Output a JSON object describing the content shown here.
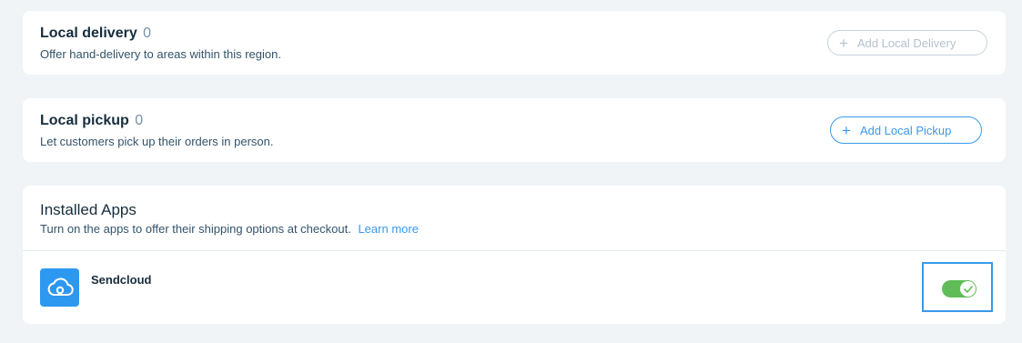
{
  "local_delivery": {
    "title": "Local delivery",
    "count": "0",
    "subtitle": "Offer hand-delivery to areas within this region.",
    "button_label": "Add Local Delivery",
    "button_state": "disabled"
  },
  "local_pickup": {
    "title": "Local pickup",
    "count": "0",
    "subtitle": "Let customers pick up their orders in person.",
    "button_label": "Add Local Pickup"
  },
  "installed_apps": {
    "title": "Installed Apps",
    "subtitle": "Turn on the apps to offer their shipping options at checkout.",
    "learn_more": "Learn more",
    "apps": [
      {
        "name": "Sendcloud",
        "icon": "cloud-icon",
        "enabled": true
      }
    ]
  },
  "colors": {
    "accent": "#3899ec",
    "toggle_on": "#60bc57",
    "app_icon_bg": "#2d98f0",
    "page_bg": "#f0f4f7"
  }
}
